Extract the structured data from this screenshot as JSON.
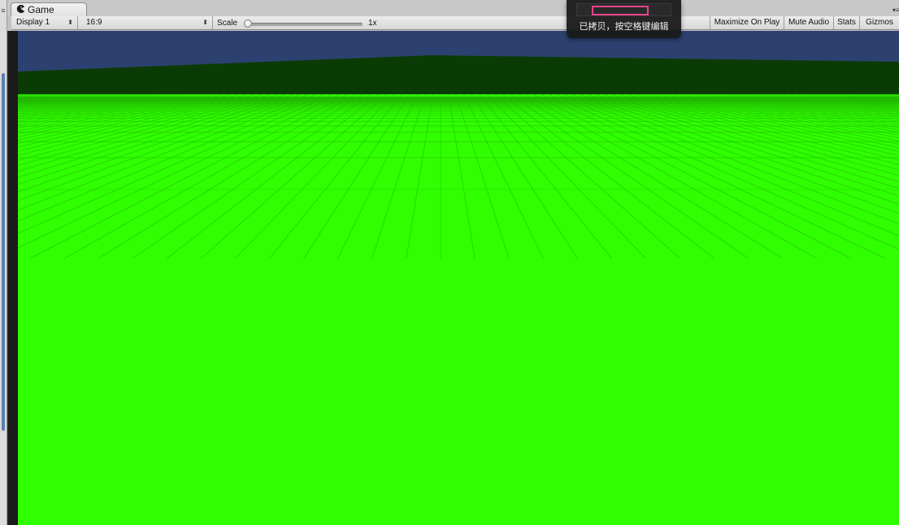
{
  "window": {
    "tab_label": "Game",
    "tab_icon": "game-pacman-icon",
    "panel_menu_icon": "panel-menu-icon",
    "window_menu_icon": "window-menu-icon"
  },
  "toolbar": {
    "display_select": {
      "value": "Display 1",
      "icon": "popup-arrows-icon"
    },
    "aspect_select": {
      "value": "16:9",
      "icon": "popup-arrows-icon"
    },
    "scale": {
      "label": "Scale",
      "value_text": "1x",
      "value_fraction": 0.0
    },
    "buttons": {
      "maximize_on_play": "Maximize On Play",
      "mute_audio": "Mute Audio",
      "stats": "Stats",
      "gizmos": "Gizmos"
    }
  },
  "viewport": {
    "sky_color": "#2c4170",
    "far_ground_color": "#0b3b04",
    "ground_color": "#2fff00",
    "grid_line_color": "#22b800"
  },
  "overlay": {
    "copy_hint_text": "已拷贝，按空格键编辑",
    "highlight_color": "#e8428b"
  }
}
